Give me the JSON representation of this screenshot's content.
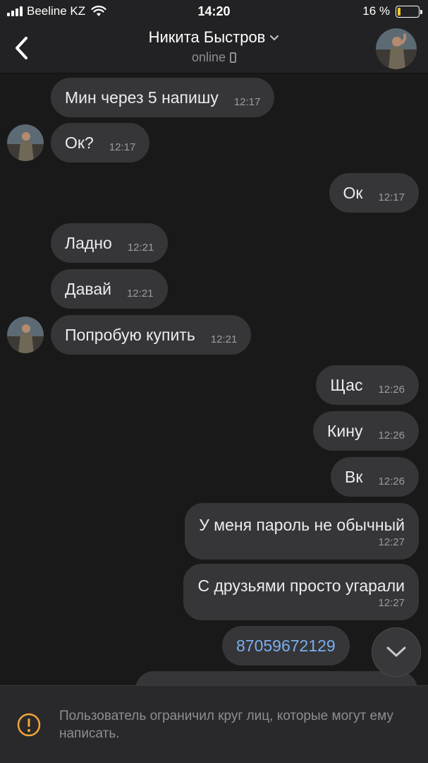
{
  "status_bar": {
    "carrier": "Beeline KZ",
    "time": "14:20",
    "battery": "16 %",
    "battery_level": 0.16,
    "battery_color": "#f5c827"
  },
  "header": {
    "back_icon": "chevron-left-icon",
    "name": "Никита Быстров",
    "status": "online",
    "status_icon": "mobile-phone-icon"
  },
  "messages": [
    {
      "text": "Мин через 5 напишу",
      "time": "12:17",
      "side": "in"
    },
    {
      "text": "Ок?",
      "time": "12:17",
      "side": "in"
    },
    {
      "text": "Ок",
      "time": "12:17",
      "side": "out"
    },
    {
      "text": "Ладно",
      "time": "12:21",
      "side": "in"
    },
    {
      "text": "Давай",
      "time": "12:21",
      "side": "in"
    },
    {
      "text": "Попробую купить",
      "time": "12:21",
      "side": "in"
    },
    {
      "text": "Щас",
      "time": "12:26",
      "side": "out"
    },
    {
      "text": "Кину",
      "time": "12:26",
      "side": "out"
    },
    {
      "text": "Вк",
      "time": "12:26",
      "side": "out"
    },
    {
      "text": "У меня пароль не обычный",
      "time": "12:27",
      "side": "out"
    },
    {
      "text": "С друзьями просто угарали",
      "time": "12:27",
      "side": "out"
    },
    {
      "text": "87059672129",
      "side": "out",
      "link_color": "#7aaef0"
    }
  ],
  "banner": {
    "text": "Пользователь ограничил круг лиц, которые могут ему написать.",
    "icon": "warning-icon"
  },
  "colors": {
    "background": "#19191a",
    "bubble": "#363638",
    "header": "#222224"
  }
}
